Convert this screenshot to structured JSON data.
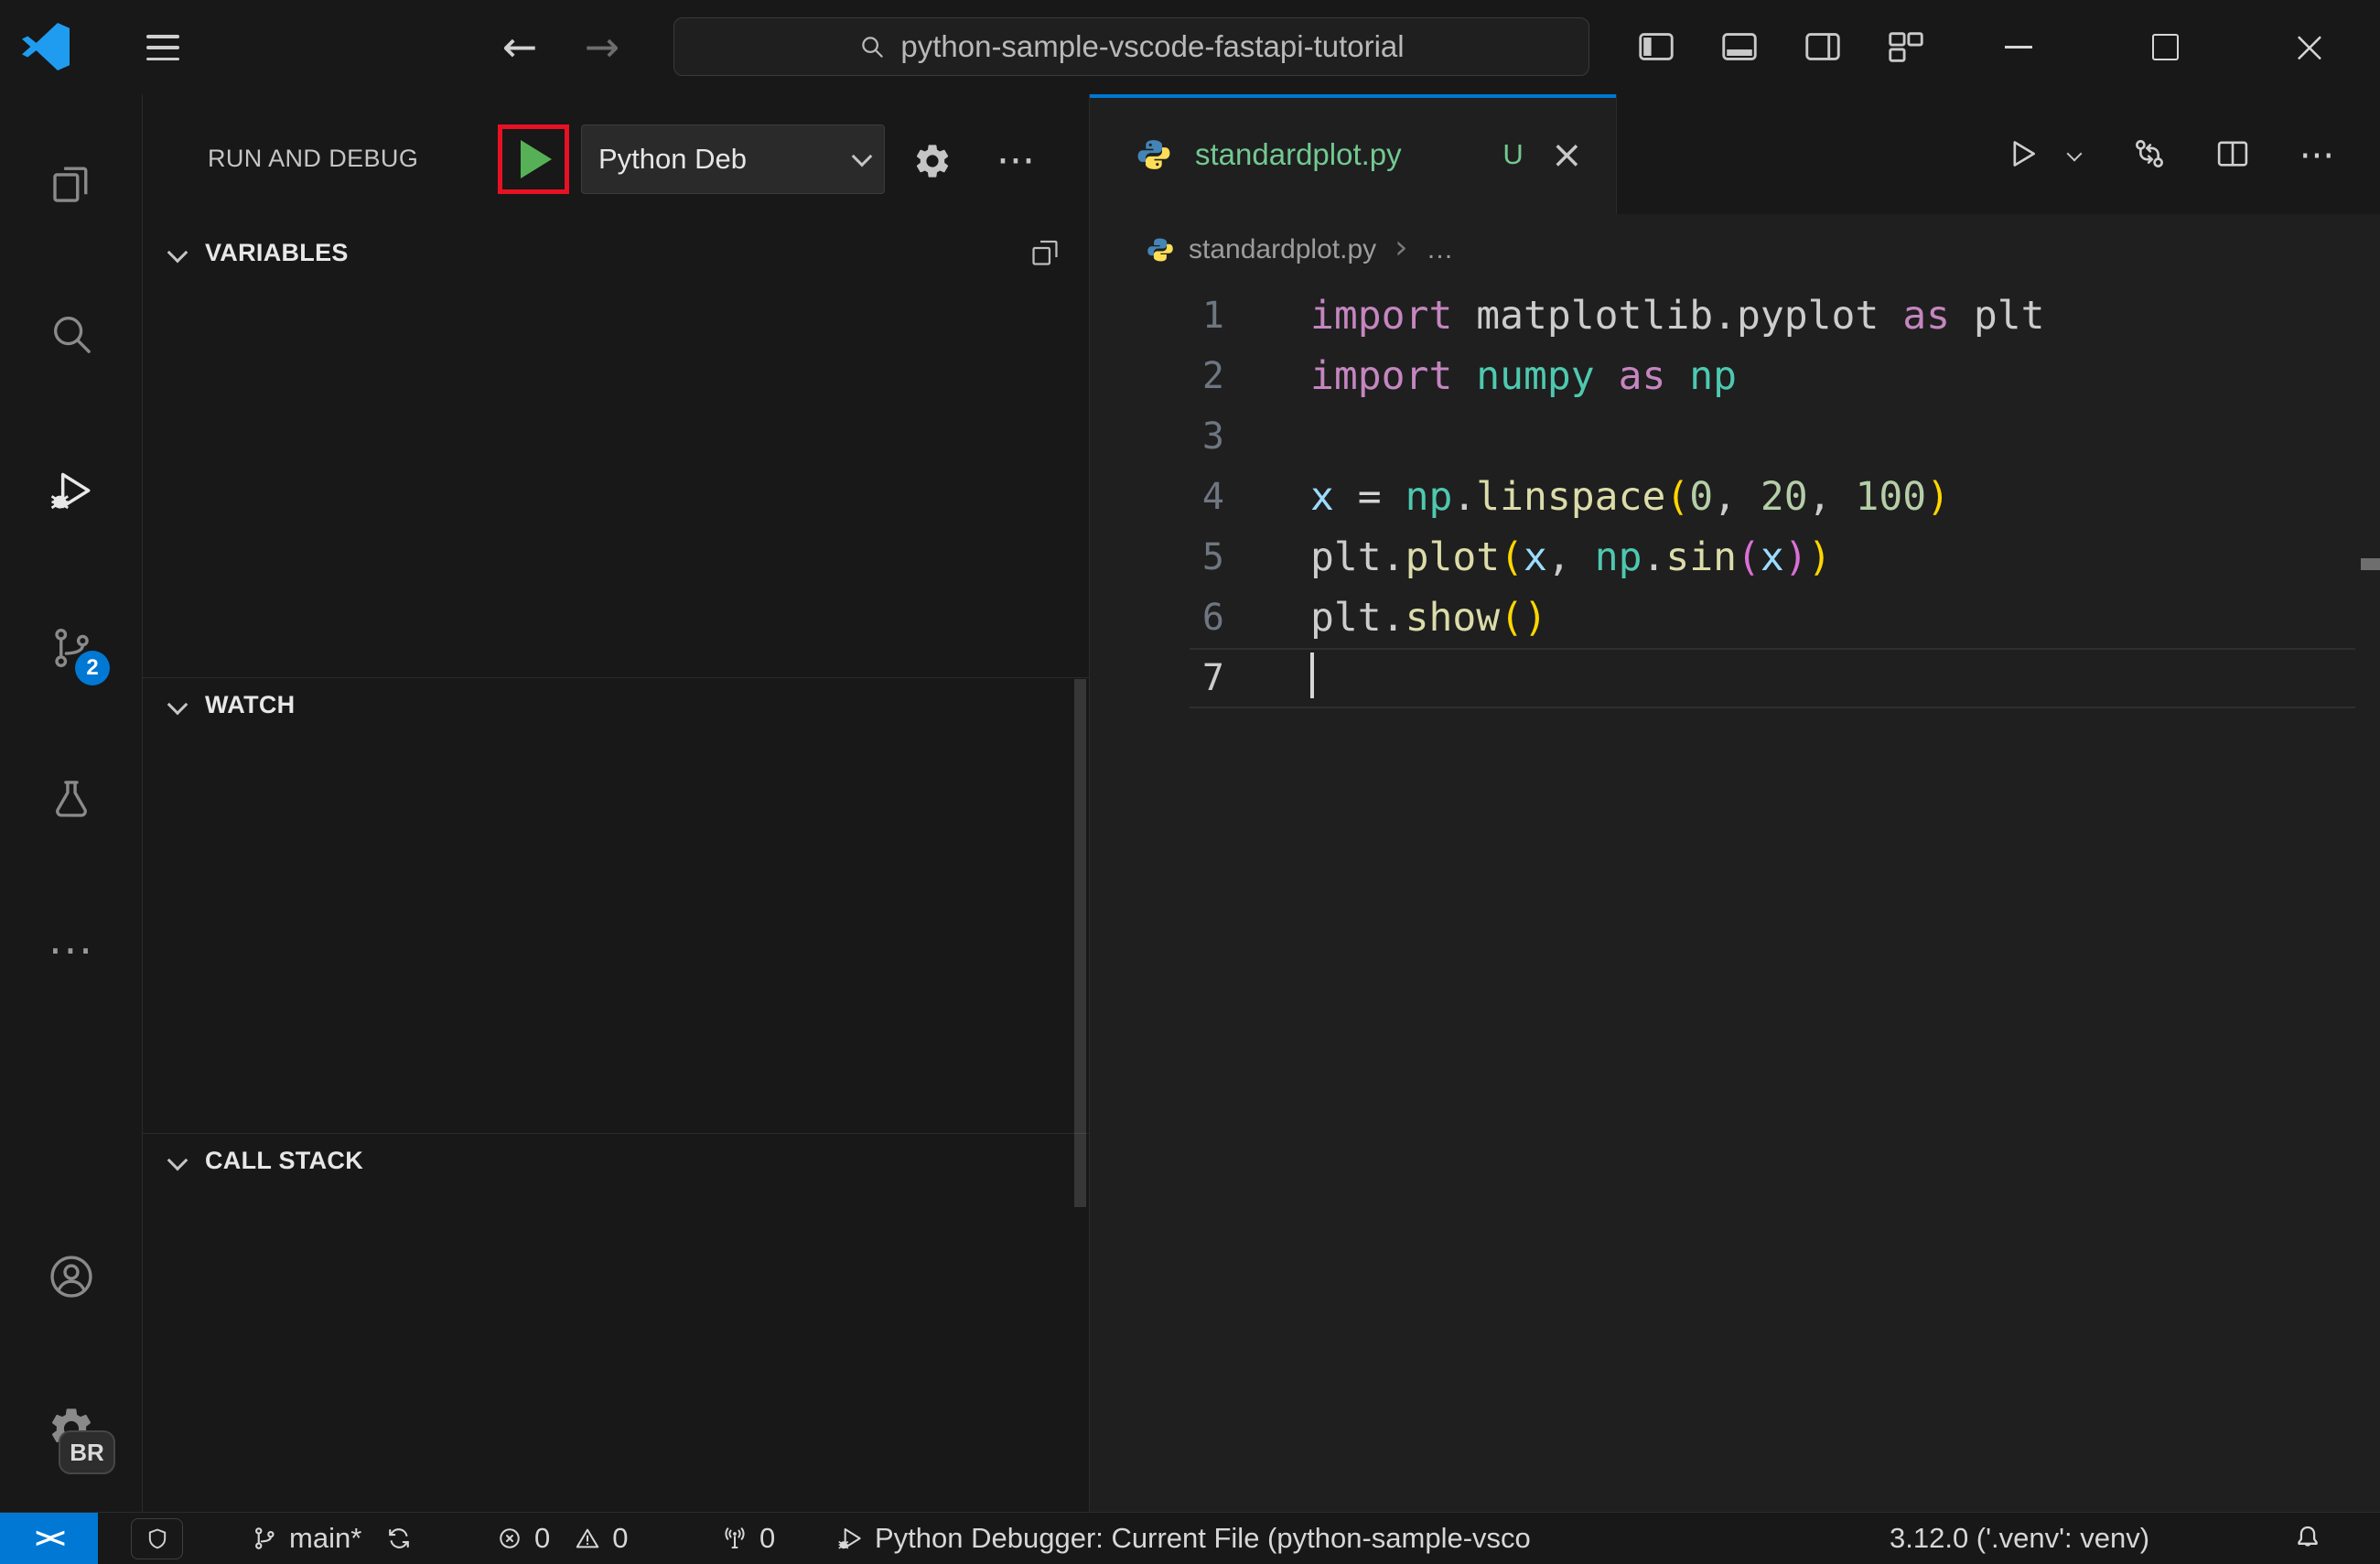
{
  "glyphs": {
    "back": "←",
    "forward": "→",
    "close": "×",
    "ellipsis": "···",
    "breadcrumb_sep": "›"
  },
  "titlebar": {
    "search_value": "python-sample-vscode-fastapi-tutorial"
  },
  "activity_bar": {
    "scm_badge": "2",
    "profile_badge": "BR"
  },
  "run_debug": {
    "title": "RUN AND DEBUG",
    "config_label": "Python Deb",
    "sections": {
      "variables": "VARIABLES",
      "watch": "WATCH",
      "call_stack": "CALL STACK"
    }
  },
  "editor": {
    "tab_label": "standardplot.py",
    "modified_badge": "U",
    "breadcrumb": {
      "file": "standardplot.py",
      "more": "…"
    },
    "token_colors": {
      "kw": "#C586C0",
      "mod": "#4EC9B0",
      "pl": "#CCCCCC",
      "fn": "#DCDCAA",
      "num": "#B5CEA8",
      "var": "#9CDCFE",
      "b1": "#FFD700",
      "b2": "#DA70D6",
      "op": "#D4D4D4"
    },
    "code_lines": [
      {
        "n": "1",
        "tokens": [
          [
            "import",
            "kw"
          ],
          [
            " ",
            "pl"
          ],
          [
            "matplotlib.pyplot",
            "pl"
          ],
          [
            " ",
            "pl"
          ],
          [
            "as",
            "kw"
          ],
          [
            " ",
            "pl"
          ],
          [
            "plt",
            "pl"
          ]
        ]
      },
      {
        "n": "2",
        "tokens": [
          [
            "import",
            "kw"
          ],
          [
            " ",
            "pl"
          ],
          [
            "numpy",
            "mod"
          ],
          [
            " ",
            "pl"
          ],
          [
            "as",
            "kw"
          ],
          [
            " ",
            "pl"
          ],
          [
            "np",
            "mod"
          ]
        ]
      },
      {
        "n": "3",
        "tokens": []
      },
      {
        "n": "4",
        "tokens": [
          [
            "x",
            "var"
          ],
          [
            " ",
            "pl"
          ],
          [
            "=",
            "op"
          ],
          [
            " ",
            "pl"
          ],
          [
            "np",
            "mod"
          ],
          [
            ".",
            "pl"
          ],
          [
            "linspace",
            "fn"
          ],
          [
            "(",
            "b1"
          ],
          [
            "0",
            "num"
          ],
          [
            ",",
            "pl"
          ],
          [
            " ",
            "pl"
          ],
          [
            "20",
            "num"
          ],
          [
            ",",
            "pl"
          ],
          [
            " ",
            "pl"
          ],
          [
            "100",
            "num"
          ],
          [
            ")",
            "b1"
          ]
        ]
      },
      {
        "n": "5",
        "tokens": [
          [
            "plt",
            "pl"
          ],
          [
            ".",
            "pl"
          ],
          [
            "plot",
            "fn"
          ],
          [
            "(",
            "b1"
          ],
          [
            "x",
            "var"
          ],
          [
            ",",
            "pl"
          ],
          [
            " ",
            "pl"
          ],
          [
            "np",
            "mod"
          ],
          [
            ".",
            "pl"
          ],
          [
            "sin",
            "fn"
          ],
          [
            "(",
            "b2"
          ],
          [
            "x",
            "var"
          ],
          [
            ")",
            "b2"
          ],
          [
            ")",
            "b1"
          ]
        ]
      },
      {
        "n": "6",
        "tokens": [
          [
            "plt",
            "pl"
          ],
          [
            ".",
            "pl"
          ],
          [
            "show",
            "fn"
          ],
          [
            "(",
            "b1"
          ],
          [
            ")",
            "b1"
          ]
        ]
      },
      {
        "n": "7",
        "tokens": [],
        "cursor": true,
        "active": true
      }
    ]
  },
  "status_bar": {
    "remote_glyph": "><",
    "branch": "main*",
    "errors": "0",
    "warnings": "0",
    "ports": "0",
    "debugger": "Python Debugger: Current File (python-sample-vsco",
    "interpreter": "3.12.0 ('.venv': venv)"
  },
  "colors": {
    "accent_blue": "#0078D4",
    "untracked_green": "#73C991",
    "debug_play_green": "#56B156",
    "annotation_red": "#E81123",
    "editor_bg": "#1F1F1F",
    "chrome_bg": "#181818"
  }
}
